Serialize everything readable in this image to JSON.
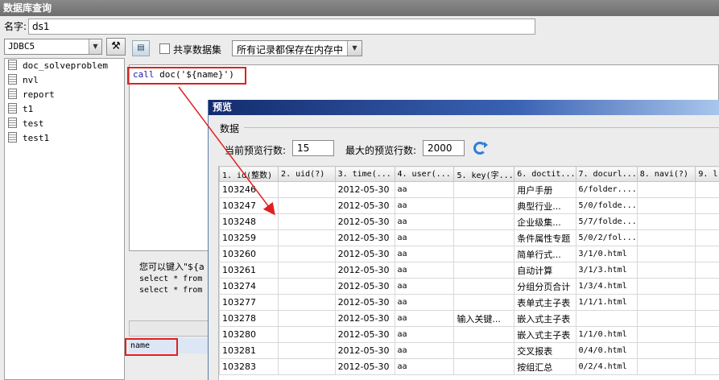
{
  "window": {
    "title": "数据库查询"
  },
  "name_field": {
    "label": "名字:",
    "value": "ds1"
  },
  "datasource": {
    "selected": "JDBC5"
  },
  "left_list": {
    "items": [
      "doc_solveproblem",
      "nvl",
      "report",
      "t1",
      "test",
      "test1"
    ]
  },
  "toolbar": {
    "share_label": "共享数据集",
    "mode_selected": "所有记录都保存在内存中"
  },
  "sql": {
    "kw": "call",
    "rest": " doc('${name}')"
  },
  "hint": {
    "text": "您可以键入\"${a",
    "lines": [
      "select * from",
      "select * from"
    ]
  },
  "params": {
    "rows": [
      "name"
    ]
  },
  "preview": {
    "title": "预览",
    "group": "数据",
    "current_rows_label": "当前预览行数:",
    "current_rows_value": "15",
    "max_rows_label": "最大的预览行数:",
    "max_rows_value": "2000",
    "columns": [
      "1. id(整数)",
      "2. uid(?)",
      "3. time(...",
      "4. user(...",
      "5. key(字...",
      "6. doctit...",
      "7. docurl...",
      "8. navi(?)",
      "9. l"
    ],
    "rows": [
      [
        "103246",
        "",
        "2012-05-30",
        "aa",
        "",
        "用户手册",
        "6/folder....",
        "",
        ""
      ],
      [
        "103247",
        "",
        "2012-05-30",
        "aa",
        "",
        "典型行业...",
        "5/0/folde...",
        "",
        ""
      ],
      [
        "103248",
        "",
        "2012-05-30",
        "aa",
        "",
        "企业级集...",
        "5/7/folde...",
        "",
        ""
      ],
      [
        "103259",
        "",
        "2012-05-30",
        "aa",
        "",
        "条件属性专题",
        "5/0/2/fol...",
        "",
        ""
      ],
      [
        "103260",
        "",
        "2012-05-30",
        "aa",
        "",
        "简单行式...",
        "3/1/0.html",
        "",
        ""
      ],
      [
        "103261",
        "",
        "2012-05-30",
        "aa",
        "",
        "自动计算",
        "3/1/3.html",
        "",
        ""
      ],
      [
        "103274",
        "",
        "2012-05-30",
        "aa",
        "",
        "分组分页合计",
        "1/3/4.html",
        "",
        ""
      ],
      [
        "103277",
        "",
        "2012-05-30",
        "aa",
        "",
        "表单式主子表",
        "1/1/1.html",
        "",
        ""
      ],
      [
        "103278",
        "",
        "2012-05-30",
        "aa",
        "输入关键...",
        "嵌入式主子表",
        "",
        "",
        ""
      ],
      [
        "103280",
        "",
        "2012-05-30",
        "aa",
        "",
        "嵌入式主子表",
        "1/1/0.html",
        "",
        ""
      ],
      [
        "103281",
        "",
        "2012-05-30",
        "aa",
        "",
        "交叉报表",
        "0/4/0.html",
        "",
        ""
      ],
      [
        "103283",
        "",
        "2012-05-30",
        "aa",
        "",
        "按组汇总",
        "0/2/4.html",
        "",
        ""
      ]
    ]
  },
  "colors": {
    "highlight": "#e02020",
    "title_blue": "#132c6e",
    "keyword": "#1a1aa6"
  }
}
